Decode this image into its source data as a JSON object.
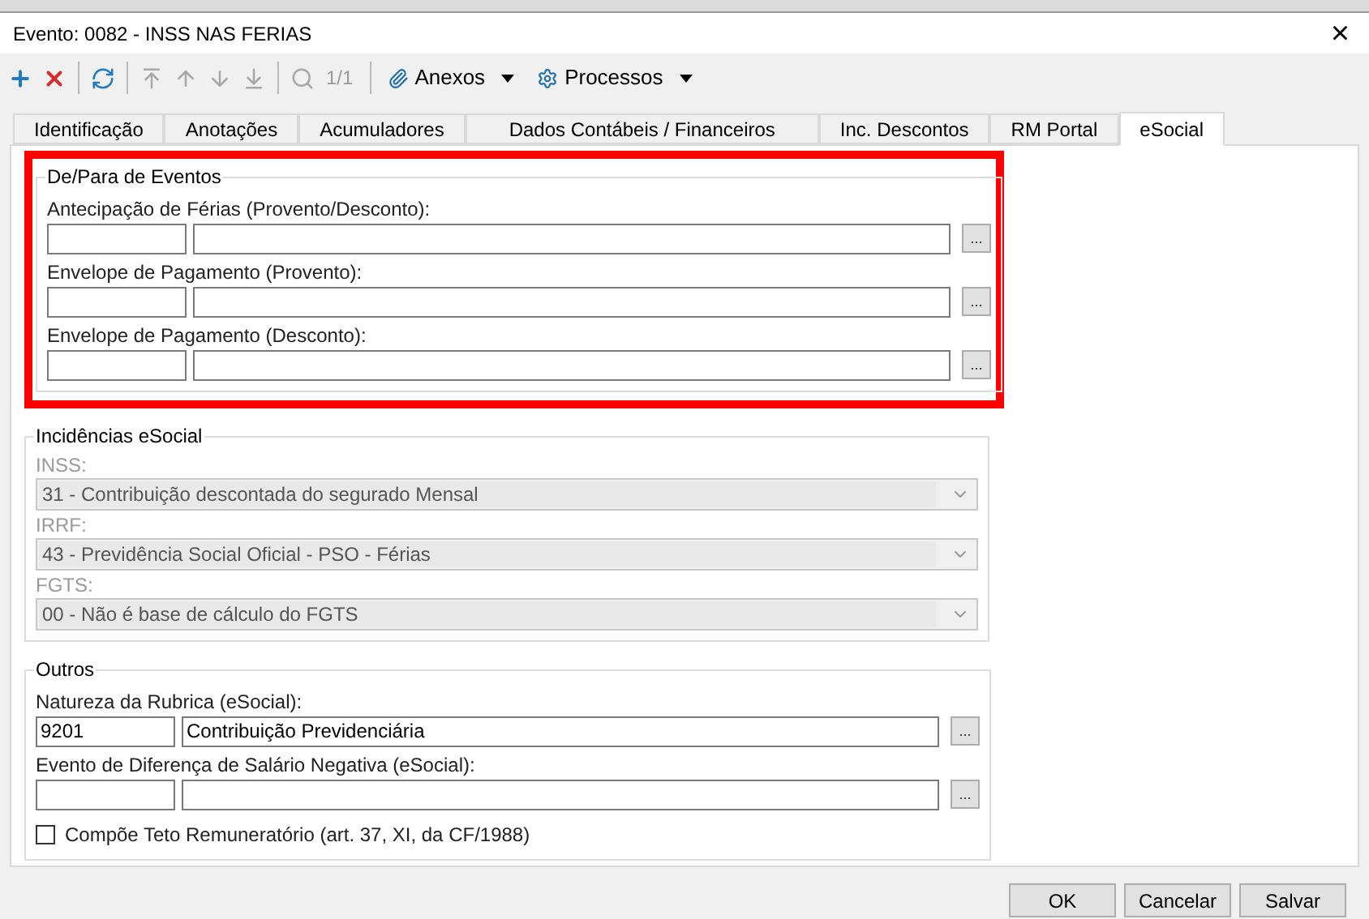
{
  "window": {
    "title": "Evento: 0082 - INSS NAS FERIAS",
    "close": "×"
  },
  "toolbar": {
    "buttons": [
      {
        "kind": "add",
        "disabled": false
      },
      {
        "kind": "delete",
        "disabled": false
      },
      {
        "kind": "refresh",
        "disabled": false
      },
      {
        "kind": "first",
        "disabled": true
      },
      {
        "kind": "up",
        "disabled": true
      },
      {
        "kind": "down",
        "disabled": true
      },
      {
        "kind": "last",
        "disabled": true
      },
      {
        "kind": "search",
        "disabled": true
      }
    ],
    "page": "1/1",
    "menus": [
      {
        "kind": "attach",
        "label": "Anexos"
      },
      {
        "kind": "gear",
        "label": "Processos"
      }
    ]
  },
  "tabs": [
    {
      "label": "Identificação",
      "selected": false
    },
    {
      "label": "Anotações",
      "selected": false
    },
    {
      "label": "Acumuladores",
      "selected": false
    },
    {
      "label": "Dados Contábeis / Financeiros",
      "selected": false
    },
    {
      "label": "Inc. Descontos",
      "selected": false
    },
    {
      "label": "RM Portal",
      "selected": false
    },
    {
      "label": "eSocial",
      "selected": true
    }
  ],
  "sections": [
    {
      "kind": "lookups",
      "title": "De/Para de Eventos",
      "highlighted": true,
      "fields": [
        {
          "label": "Antecipação de Férias (Provento/Desconto):",
          "button": "..."
        },
        {
          "label": "Envelope de Pagamento (Provento):",
          "button": "..."
        },
        {
          "label": "Envelope de Pagamento (Desconto):",
          "button": "..."
        }
      ]
    },
    {
      "kind": "selects",
      "title": "Incidências eSocial",
      "highlighted": false,
      "fields": [
        {
          "label": "INSS:",
          "value": "31 - Contribuição descontada do segurado Mensal",
          "disabled": true
        },
        {
          "label": "IRRF:",
          "value": "43 - Previdência Social Oficial - PSO - Férias",
          "disabled": true
        },
        {
          "label": "FGTS:",
          "value": "00 - Não é base de cálculo do FGTS",
          "disabled": true
        }
      ]
    },
    {
      "kind": "lookups",
      "title": "Outros",
      "highlighted": false,
      "fields": [
        {
          "label": "Natureza da Rubrica (eSocial):",
          "code": "9201",
          "description": "Contribuição Previdenciária",
          "button": "..."
        },
        {
          "label": "Evento de Diferença de Salário Negativa (eSocial):",
          "button": "..."
        }
      ],
      "checkbox": {
        "label": "Compõe Teto Remuneratório (art. 37, XI, da CF/1988)",
        "checked": false
      }
    }
  ],
  "footer": {
    "buttons": [
      "OK",
      "Cancelar",
      "Salvar"
    ]
  }
}
